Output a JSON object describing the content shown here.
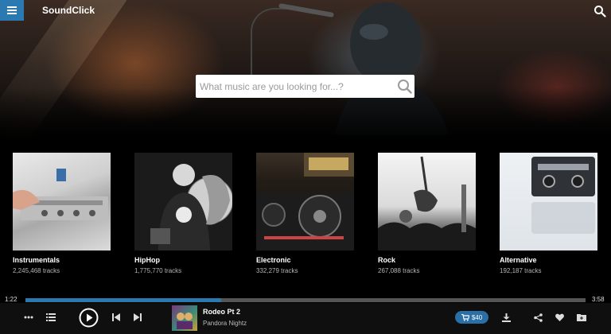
{
  "header": {
    "brand": "SoundClick",
    "search_placeholder": "What music are you looking for...?"
  },
  "genres": [
    {
      "name": "Instrumentals",
      "tracks": "2,245,468 tracks"
    },
    {
      "name": "HipHop",
      "tracks": "1,775,770 tracks"
    },
    {
      "name": "Electronic",
      "tracks": "332,279 tracks"
    },
    {
      "name": "Rock",
      "tracks": "267,088 tracks"
    },
    {
      "name": "Alternative",
      "tracks": "192,187 tracks"
    }
  ],
  "player": {
    "elapsed": "1:22",
    "duration": "3:58",
    "progress_fraction": 0.35,
    "track_title": "Rodeo Pt 2",
    "artist": "Pandora Nightz",
    "price": "$40"
  },
  "colors": {
    "accent": "#2a79b0"
  }
}
